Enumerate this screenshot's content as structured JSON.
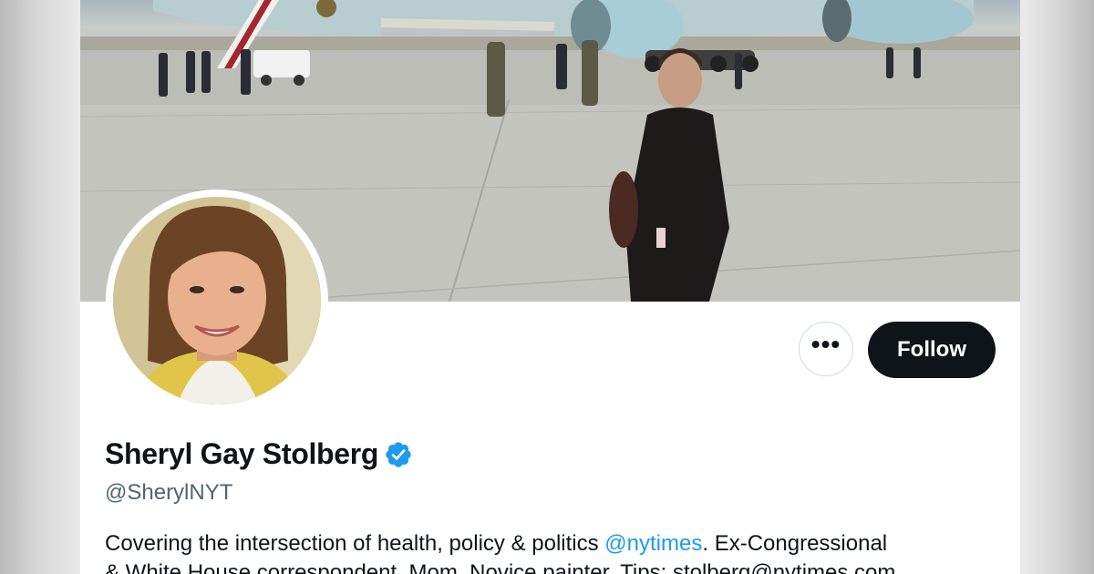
{
  "profile": {
    "display_name": "Sheryl Gay Stolberg",
    "handle": "@SherylNYT",
    "verified_icon": "verified-badge-icon",
    "bio": {
      "text_before_mention": "Covering the intersection of health, policy & politics ",
      "mention": "@nytimes",
      "text_after_mention": ". Ex-Congressional",
      "line2": "& White House correspondent. Mom. Novice painter. Tips: stolberg@nytimes.com"
    }
  },
  "actions": {
    "more_icon": "more-horizontal-icon",
    "more_label": "•••",
    "follow_label": "Follow"
  },
  "colors": {
    "follow_bg": "#0f1419",
    "link": "#1d9bf0",
    "verified": "#1d9bf0",
    "handle": "#536471"
  }
}
